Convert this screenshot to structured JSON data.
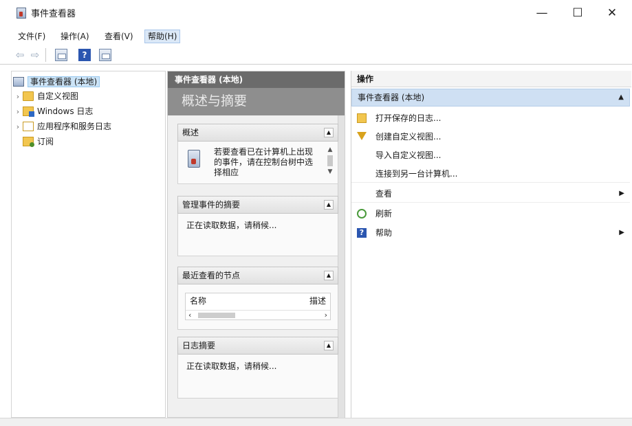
{
  "window": {
    "title": "事件查看器",
    "minimize_glyph": "—",
    "maximize_glyph": "☐",
    "close_glyph": "✕"
  },
  "menu": {
    "items": [
      "文件(F)",
      "操作(A)",
      "查看(V)",
      "帮助(H)"
    ]
  },
  "toolbar": {
    "back_glyph": "⇦",
    "forward_glyph": "⇨",
    "help_glyph": "?"
  },
  "tree": {
    "items": [
      {
        "label": "事件查看器 (本地)",
        "icon": "event-viewer-icon"
      },
      {
        "label": "自定义视图",
        "icon": "folder-icon"
      },
      {
        "label": "Windows 日志",
        "icon": "windows-logs-icon"
      },
      {
        "label": "应用程序和服务日志",
        "icon": "folder-icon"
      },
      {
        "label": "订阅",
        "icon": "subscription-icon"
      }
    ],
    "chevron": "›"
  },
  "middle": {
    "header": "事件查看器 (本地)",
    "banner": "概述与摘要",
    "sections": {
      "overview": {
        "title": "概述",
        "text": "若要查看已在计算机上出现的事件，请在控制台树中选择相应"
      },
      "admin_summary": {
        "title": "管理事件的摘要",
        "text": "正在读取数据，请稍候..."
      },
      "recent_nodes": {
        "title": "最近查看的节点",
        "col_name": "名称",
        "col_desc": "描述"
      },
      "log_summary": {
        "title": "日志摘要",
        "text": "正在读取数据，请稍候..."
      }
    },
    "toggle_glyph": "▲"
  },
  "actions": {
    "header": "操作",
    "group": "事件查看器 (本地)",
    "items": [
      {
        "label": "打开保存的日志...",
        "icon": "open-folder-icon"
      },
      {
        "label": "创建自定义视图...",
        "icon": "filter-icon"
      },
      {
        "label": "导入自定义视图..."
      },
      {
        "label": "连接到另一台计算机..."
      },
      {
        "label": "查看",
        "submenu": true
      },
      {
        "label": "刷新",
        "icon": "refresh-icon"
      },
      {
        "label": "帮助",
        "icon": "help-icon",
        "submenu": true
      }
    ],
    "submenu_arrow": "▶",
    "group_caret": "▲"
  },
  "colors": {
    "selection": "#cce4f7",
    "action_group": "#cfe0f3",
    "middle_header": "#6b6b6b",
    "middle_banner": "#8e8e8e"
  }
}
